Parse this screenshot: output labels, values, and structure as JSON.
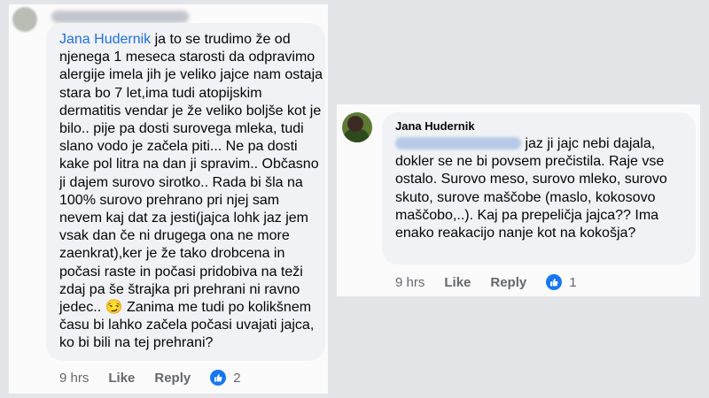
{
  "left_comment": {
    "author": "Jana Hudernik",
    "text": " ja to se trudimo že od njenega 1 meseca starosti da odpravimo alergije imela jih je veliko jajce nam ostaja stara bo 7 let,ima tudi atopijskim dermatitis vendar je že veliko boljše kot je bilo.. pije pa dosti surovega mleka, tudi slano vodo je začela piti... Ne pa dosti kake pol litra na dan ji spravim.. Občasno ji dajem surovo sirotko.. Rada bi šla na 100% surovo prehrano pri njej sam nevem kaj dat za jesti(jajca lohk jaz jem vsak dan če ni drugega ona ne more zaenkrat),ker je že tako drobcena in počasi raste in počasi pridobiva na teži zdaj pa še štrajka pri prehrani ni ravno jedec.. 😏 Zanima me tudi po kolikšnem času bi lahko začela počasi uvajati jajca, ko bi bili na tej prehrani?",
    "time": "9 hrs",
    "like_label": "Like",
    "reply_label": "Reply",
    "reaction_count": "2"
  },
  "right_comment": {
    "author": "Jana Hudernik",
    "text": " jaz ji jajc nebi dajala, dokler se ne bi povsem prečistila. Raje vse ostalo. Surovo meso, surovo mleko, surovo skuto, surove maščobe (maslo, kokosovo maščobo,..). Kaj pa prepeličja jajca?? Ima enako reakacijo nanje kot na kokošja?",
    "time": "9 hrs",
    "like_label": "Like",
    "reply_label": "Reply",
    "reaction_count": "1"
  },
  "colors": {
    "link_blue": "#216fdb",
    "like_blue": "#1877f2",
    "meta_gray": "#65676b",
    "bubble_bg": "#f0f2f5"
  },
  "icons": {
    "reaction": "thumbs-up-icon"
  }
}
